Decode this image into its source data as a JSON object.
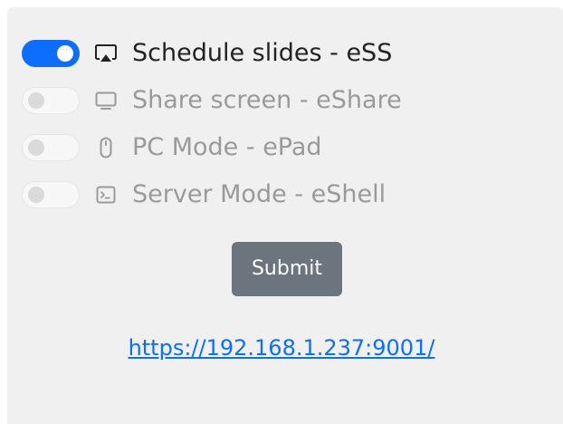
{
  "options": [
    {
      "label": "Schedule slides - eSS",
      "enabled": true,
      "icon": "airplay-icon"
    },
    {
      "label": "Share screen - eShare",
      "enabled": false,
      "icon": "display-icon"
    },
    {
      "label": "PC Mode - ePad",
      "enabled": false,
      "icon": "mouse-icon"
    },
    {
      "label": "Server Mode - eShell",
      "enabled": false,
      "icon": "terminal-icon"
    }
  ],
  "submit_label": "Submit",
  "link": {
    "text": "https://192.168.1.237:9001/",
    "href": "https://192.168.1.237:9001/"
  },
  "colors": {
    "accent": "#0d6efd",
    "button": "#6c757d",
    "panel": "#f0f0f0",
    "active_text": "#222222",
    "inactive_text": "#9a9a9a"
  }
}
